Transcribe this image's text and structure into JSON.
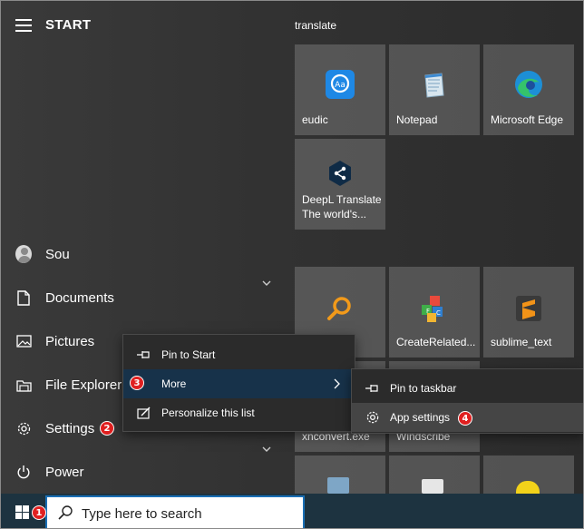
{
  "start_menu": {
    "title": "START",
    "user": "Sou",
    "rail": [
      {
        "label": "Documents",
        "icon": "document-icon"
      },
      {
        "label": "Pictures",
        "icon": "pictures-icon"
      },
      {
        "label": "File Explorer",
        "icon": "file-explorer-icon"
      },
      {
        "label": "Settings",
        "icon": "gear-icon"
      },
      {
        "label": "Power",
        "icon": "power-icon"
      }
    ]
  },
  "tiles": {
    "group_label": "translate",
    "group1": [
      {
        "label": "eudic",
        "icon": "eudic-icon"
      },
      {
        "label": "Notepad",
        "icon": "notepad-icon"
      },
      {
        "label": "Microsoft Edge",
        "icon": "edge-icon"
      },
      {
        "label": "DeepL Translate\nThe world's...",
        "icon": "deepl-icon"
      }
    ],
    "group2": [
      {
        "label": "",
        "icon": "search-magnifier-icon"
      },
      {
        "label": "CreateRelated...",
        "icon": "create-related-icon"
      },
      {
        "label": "sublime_text",
        "icon": "sublime-icon"
      },
      {
        "label": "xnconvert.exe",
        "icon": ""
      },
      {
        "label": "Windscribe",
        "icon": ""
      }
    ]
  },
  "context_menu": {
    "items": [
      {
        "label": "Pin to Start",
        "icon": "pin-icon"
      },
      {
        "label": "More",
        "icon": ""
      },
      {
        "label": "Personalize this list",
        "icon": "personalize-icon"
      }
    ]
  },
  "submenu": {
    "items": [
      {
        "label": "Pin to taskbar",
        "icon": "pin-icon"
      },
      {
        "label": "App settings",
        "icon": "gear-icon"
      }
    ]
  },
  "badges": {
    "b1": "1",
    "b2": "2",
    "b3": "3",
    "b4": "4"
  },
  "taskbar": {
    "search_placeholder": "Type here to search"
  },
  "colors": {
    "accent_blue": "#1a6fb5",
    "badge_red": "#e02020",
    "selected_menu": "#17324a",
    "taskbar": "#1d3340"
  }
}
